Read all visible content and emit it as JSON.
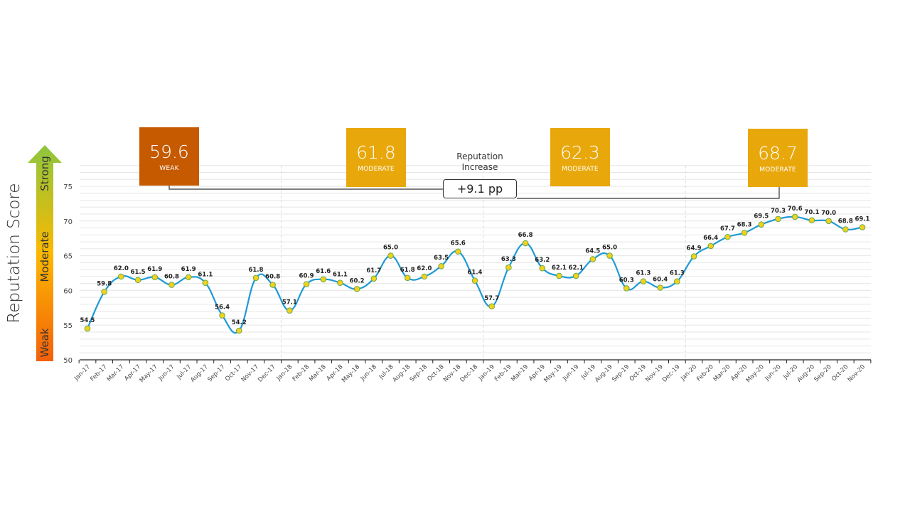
{
  "chart_data": {
    "type": "line",
    "title": "",
    "ylabel": "Reputation Score",
    "xlabel": "",
    "ylim": [
      50,
      78
    ],
    "yticks": [
      50,
      55,
      60,
      65,
      70,
      75
    ],
    "grid": true,
    "smooth": true,
    "line_color": "#1e9ad6",
    "marker_fill": "#f2d21b",
    "marker_stroke": "#6aa84f",
    "categories": [
      "Jan-17",
      "Feb-17",
      "Mar-17",
      "Apr-17",
      "May-17",
      "Jun-17",
      "Jul-17",
      "Aug-17",
      "Sep-17",
      "Oct-17",
      "Nov-17",
      "Dec-17",
      "Jan-18",
      "Feb-18",
      "Mar-18",
      "Apr-18",
      "May-18",
      "Jun-18",
      "Jul-18",
      "Aug-18",
      "Sep-18",
      "Oct-18",
      "Nov-18",
      "Dec-18",
      "Jan-19",
      "Feb-19",
      "Mar-19",
      "Apr-19",
      "May-19",
      "Jun-19",
      "Jul-19",
      "Aug-19",
      "Sep-19",
      "Oct-19",
      "Nov-19",
      "Dec-19",
      "Jan-20",
      "Feb-20",
      "Mar-20",
      "Apr-20",
      "May-20",
      "Jun-20",
      "Jul-20",
      "Aug-20",
      "Sep-20",
      "Oct-20",
      "Nov-20"
    ],
    "series": [
      {
        "name": "Reputation Score",
        "values": [
          54.5,
          59.8,
          62.0,
          61.5,
          61.9,
          60.8,
          61.9,
          61.1,
          56.4,
          54.2,
          61.8,
          60.8,
          57.1,
          60.9,
          61.6,
          61.1,
          60.2,
          61.7,
          65.0,
          61.8,
          62.0,
          63.5,
          65.6,
          61.4,
          57.7,
          63.3,
          66.8,
          63.2,
          62.1,
          62.1,
          64.5,
          65.0,
          60.3,
          61.3,
          60.4,
          61.3,
          64.9,
          66.4,
          67.7,
          68.3,
          69.5,
          70.3,
          70.6,
          70.1,
          70.0,
          68.8,
          69.1
        ]
      }
    ],
    "year_separators_before": [
      "Jan-18",
      "Jan-19",
      "Jan-20"
    ],
    "scale_arrow": {
      "labels": [
        "Weak",
        "Moderate",
        "Strong"
      ],
      "colors": [
        "#f4600c",
        "#fbb900",
        "#8cc63f"
      ]
    },
    "annual_averages": [
      {
        "value": "59.6",
        "rating": "WEAK",
        "color": "#c55a00"
      },
      {
        "value": "61.8",
        "rating": "MODERATE",
        "color": "#e8a80c"
      },
      {
        "value": "62.3",
        "rating": "MODERATE",
        "color": "#e8a80c"
      },
      {
        "value": "68.7",
        "rating": "MODERATE",
        "color": "#e8a80c"
      }
    ],
    "increase": {
      "title_line1": "Reputation",
      "title_line2": "Increase",
      "value": "+9.1 pp"
    }
  }
}
